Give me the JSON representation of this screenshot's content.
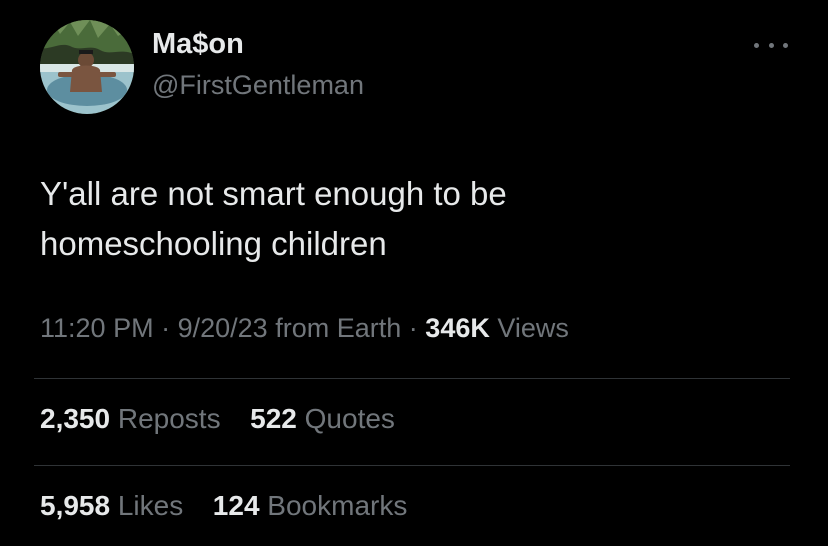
{
  "user": {
    "display_name": "Ma$on",
    "handle": "@FirstGentleman"
  },
  "tweet": {
    "text_line1": "Y'all are not smart enough to be",
    "text_line2": "homeschooling children"
  },
  "meta": {
    "time": "11:20 PM",
    "sep1": "·",
    "date": "9/20/23",
    "source": "from Earth",
    "sep2": "·",
    "views_count": "346K",
    "views_label": "Views"
  },
  "stats": {
    "reposts_count": "2,350",
    "reposts_label": "Reposts",
    "quotes_count": "522",
    "quotes_label": "Quotes",
    "likes_count": "5,958",
    "likes_label": "Likes",
    "bookmarks_count": "124",
    "bookmarks_label": "Bookmarks"
  },
  "icons": {
    "more": "more-horizontal-icon"
  },
  "colors": {
    "background": "#000000",
    "primary_text": "#e7e9ea",
    "secondary_text": "#71767b",
    "divider": "#2f3336"
  }
}
